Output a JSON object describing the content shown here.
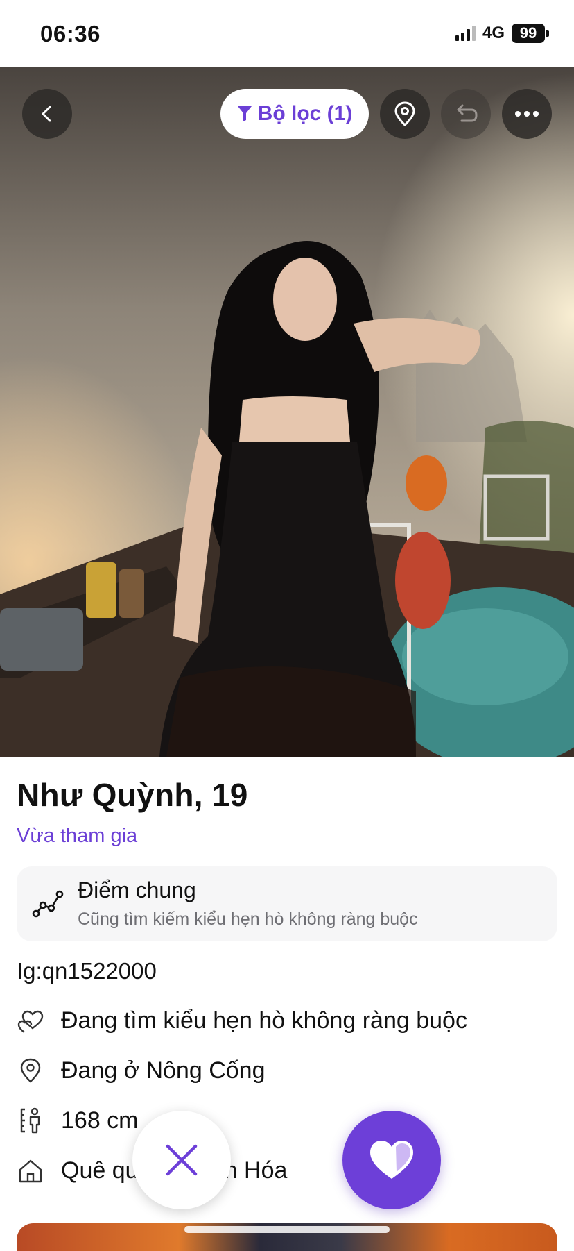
{
  "status_bar": {
    "time": "06:36",
    "network": "4G",
    "battery": "99"
  },
  "toolbar": {
    "filter_label": "Bộ lọc (1)",
    "back_icon": "chevron-left-icon",
    "filter_icon": "funnel-icon",
    "location_icon": "map-pin-icon",
    "undo_icon": "undo-icon",
    "more_icon": "ellipsis-icon"
  },
  "profile": {
    "name_age": "Như Quỳnh, 19",
    "status": "Vừa tham gia",
    "common": {
      "title": "Điểm chung",
      "subtitle": "Cũng tìm kiếm kiểu hẹn hò không ràng buộc"
    },
    "bio": "Ig:qn1522000",
    "details": [
      {
        "icon": "hearts-icon",
        "text": "Đang tìm kiểu hẹn hò không ràng buộc"
      },
      {
        "icon": "map-pin-icon",
        "text": "Đang ở Nông Cống"
      },
      {
        "icon": "height-icon",
        "text": "168 cm"
      },
      {
        "icon": "home-icon",
        "text": "Quê quán Thanh Hóa"
      }
    ]
  },
  "actions": {
    "dislike_icon": "close-icon",
    "like_icon": "heart-icon"
  },
  "colors": {
    "accent": "#6d3fd8",
    "text": "#111111",
    "muted": "#6e6e73",
    "card_bg": "#f6f6f7"
  }
}
